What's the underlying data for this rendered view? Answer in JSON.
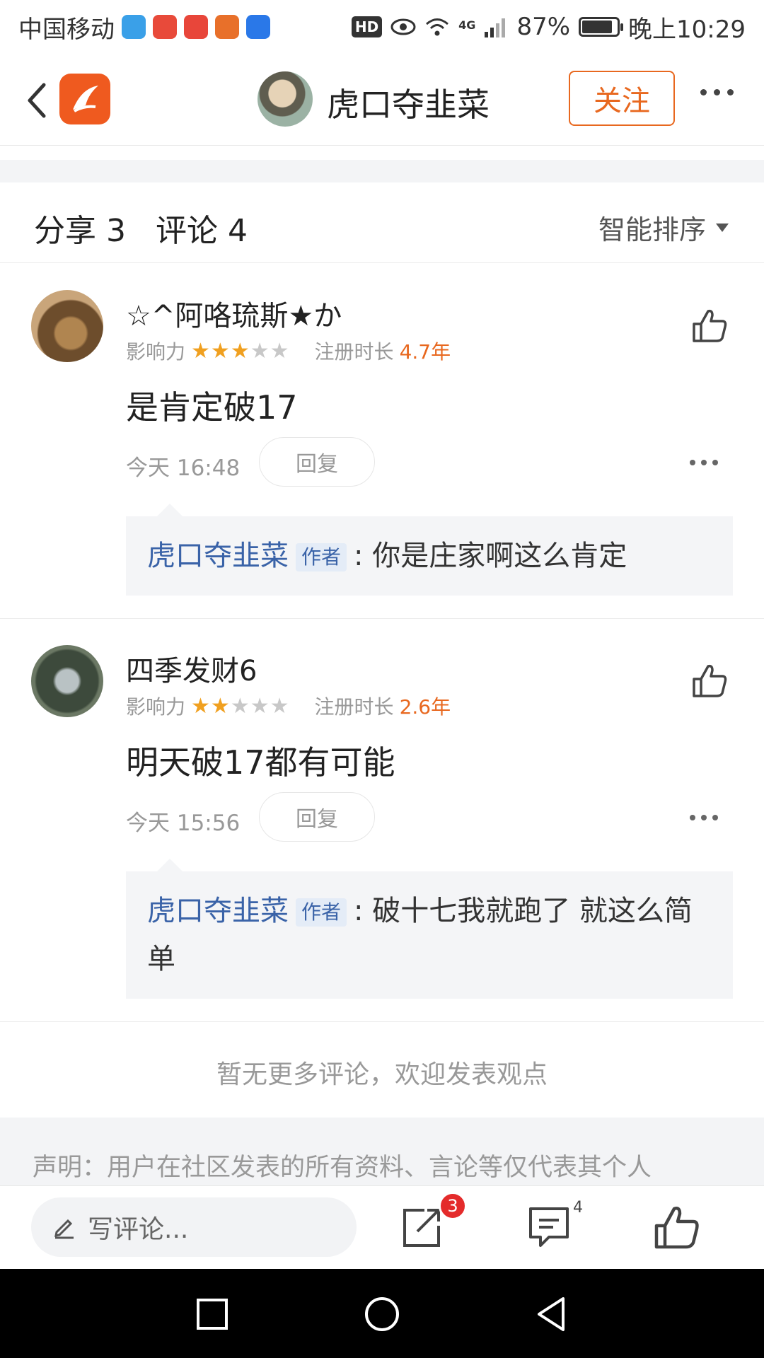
{
  "status_bar": {
    "carrier": "中国移动",
    "network": "4G",
    "hd": "HD",
    "battery_percent": "87%",
    "battery_level": 0.87,
    "time": "晚上10:29"
  },
  "header": {
    "profile_name": "虎口夺韭菜",
    "follow_label": "关注"
  },
  "tabs": {
    "share_label": "分享 3",
    "comment_label": "评论 4",
    "sort_label": "智能排序"
  },
  "comments": [
    {
      "username": "☆^阿咯琉斯★か",
      "influence_label": "影响力",
      "stars": 3,
      "reg_label": "注册时长",
      "reg_value": "4.7年",
      "text": "是肯定破17",
      "time": "今天 16:48",
      "reply_label": "回复",
      "reply": {
        "author": "虎口夺韭菜",
        "tag": "作者",
        "text": ": 你是庄家啊这么肯定"
      }
    },
    {
      "username": "四季发财6",
      "influence_label": "影响力",
      "stars": 2,
      "reg_label": "注册时长",
      "reg_value": "2.6年",
      "text": "明天破17都有可能",
      "time": "今天 15:56",
      "reply_label": "回复",
      "reply": {
        "author": "虎口夺韭菜",
        "tag": "作者",
        "text": ": 破十七我就跑了 就这么简单"
      }
    }
  ],
  "no_more_text": "暂无更多评论，欢迎发表观点",
  "disclaimer": "声明：用户在社区发表的所有资料、言论等仅代表其个人",
  "bottom_bar": {
    "write_placeholder": "写评论...",
    "share_badge": "3",
    "comment_count": "4"
  },
  "colors": {
    "accent": "#e8681f",
    "link": "#3a63a8",
    "badge": "#e42b2b"
  }
}
